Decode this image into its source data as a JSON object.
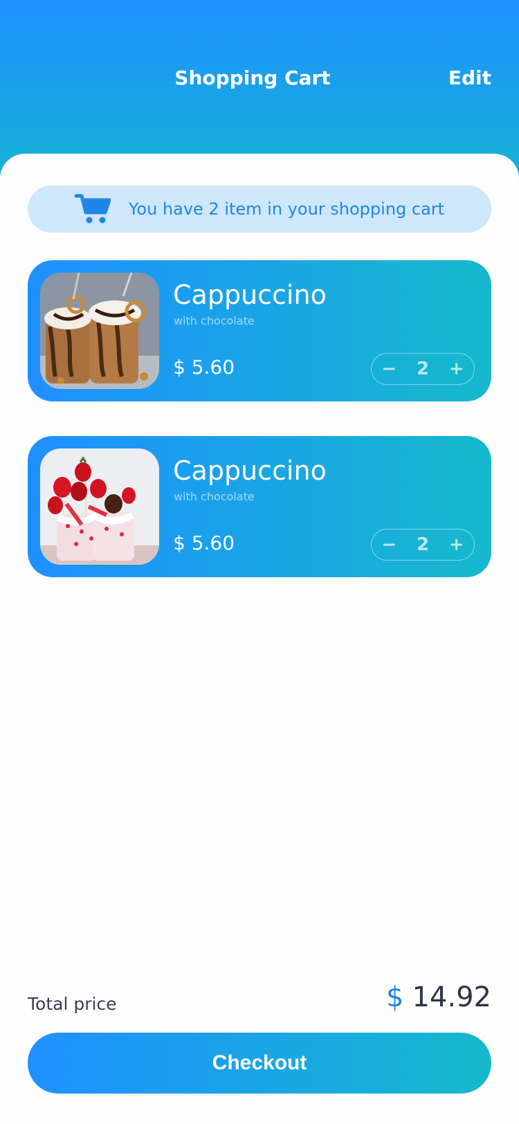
{
  "header": {
    "title": "Shopping Cart",
    "edit_label": "Edit"
  },
  "banner": {
    "icon": "cart-icon",
    "text": "You have 2 item in your shopping cart"
  },
  "items": [
    {
      "name": "Cappuccino",
      "subtitle": "with chocolate",
      "price": "$ 5.60",
      "quantity": "2",
      "decrement": "−",
      "increment": "+",
      "image": "chocolate-milkshake-photo"
    },
    {
      "name": "Cappuccino",
      "subtitle": "with chocolate",
      "price": "$ 5.60",
      "quantity": "2",
      "decrement": "−",
      "increment": "+",
      "image": "strawberry-milkshake-photo"
    }
  ],
  "total": {
    "label": "Total price",
    "currency": "$",
    "amount": "14.92"
  },
  "checkout_label": "Checkout",
  "colors": {
    "accent": "#1e90ff",
    "accent_end": "#16b9cc",
    "banner_bg": "#cfe7fb"
  }
}
